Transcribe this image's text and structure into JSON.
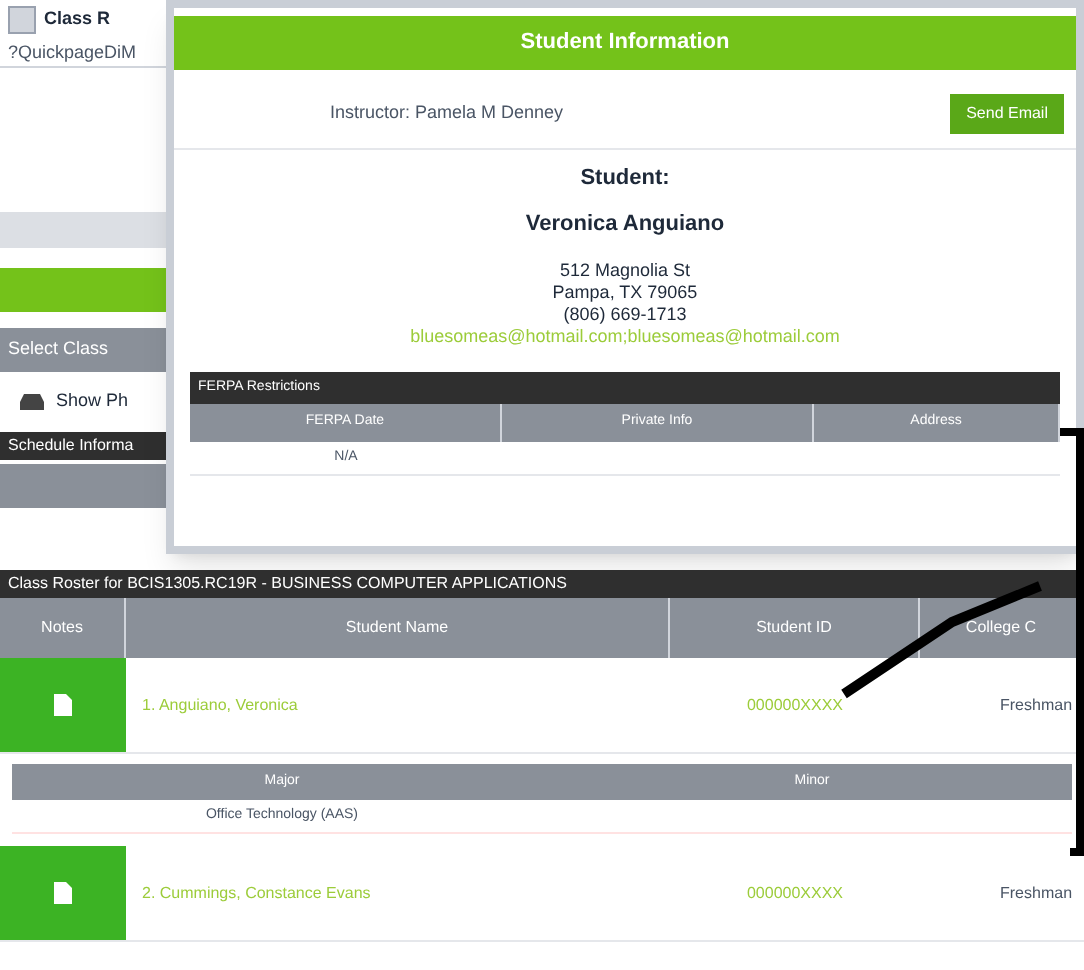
{
  "background": {
    "tab_title": "Class R",
    "url": "?QuickpageDiM",
    "select_label": "Select Class",
    "show_photos": "Show Ph",
    "schedule_header": "Schedule Informa"
  },
  "modal": {
    "title": "Student Information",
    "instructor": "Instructor: Pamela M Denney",
    "button": "Send Email",
    "student_heading": "Student:",
    "student_name": "Veronica Anguiano",
    "address": [
      "512 Magnolia St",
      "Pampa, TX 79065",
      "(806) 669-1713"
    ],
    "email": "bluesomeas@hotmail.com;bluesomeas@hotmail.com",
    "ferpa": {
      "title": "FERPA Restrictions",
      "columns": [
        "FERPA Date",
        "Private Info",
        "Address"
      ],
      "rows": [
        [
          "N/A",
          "",
          ""
        ]
      ]
    }
  },
  "roster": {
    "title": "Class Roster for BCIS1305.RC19R - BUSINESS COMPUTER APPLICATIONS",
    "columns": [
      "Notes",
      "Student Name",
      "Student ID",
      "College C"
    ],
    "rows": [
      {
        "name": "1. Anguiano, Veronica",
        "id": "000000XXXX",
        "classification": "Freshman",
        "majors": {
          "columns": [
            "Major",
            "Minor"
          ],
          "rows": [
            [
              "Office Technology (AAS)",
              ""
            ]
          ]
        }
      },
      {
        "name": "2. Cummings, Constance Evans",
        "id": "000000XXXX",
        "classification": "Freshman"
      }
    ]
  }
}
